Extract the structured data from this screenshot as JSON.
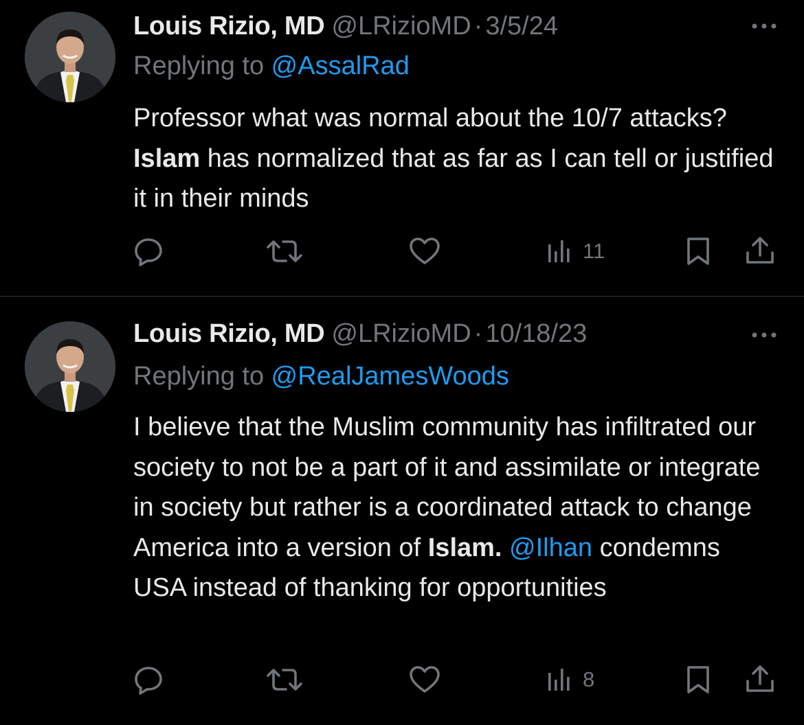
{
  "tweets": [
    {
      "author_name": "Louis Rizio, MD",
      "handle": "@LRizioMD",
      "separator": "·",
      "date": "3/5/24",
      "replying_prefix": "Replying to ",
      "replying_handle": "@AssalRad",
      "body_parts": [
        "Professor what was normal about the 10/7 attacks? ",
        "Islam",
        " has normalized that as far as I can tell or justified it in their minds"
      ],
      "views": "11",
      "icons": [
        "more-icon",
        "reply-icon",
        "repost-icon",
        "like-icon",
        "views-icon",
        "bookmark-icon",
        "share-icon"
      ]
    },
    {
      "author_name": "Louis Rizio, MD",
      "handle": "@LRizioMD",
      "separator": "·",
      "date": "10/18/23",
      "replying_prefix": "Replying to ",
      "replying_handle": "@RealJamesWoods",
      "body_parts": [
        "I believe that the Muslim community has infiltrated our society to not be a part of it and assimilate or integrate in society but rather is a coordinated attack to change America into a version of ",
        "Islam.",
        " ",
        "@Ilhan",
        " condemns USA instead of thanking for opportunities"
      ],
      "views": "8",
      "icons": [
        "more-icon",
        "reply-icon",
        "repost-icon",
        "like-icon",
        "views-icon",
        "bookmark-icon",
        "share-icon"
      ]
    }
  ],
  "colors": {
    "background": "#000000",
    "text": "#e7e9ea",
    "muted": "#71767b",
    "link": "#1d9bf0",
    "divider": "#2f3336"
  }
}
